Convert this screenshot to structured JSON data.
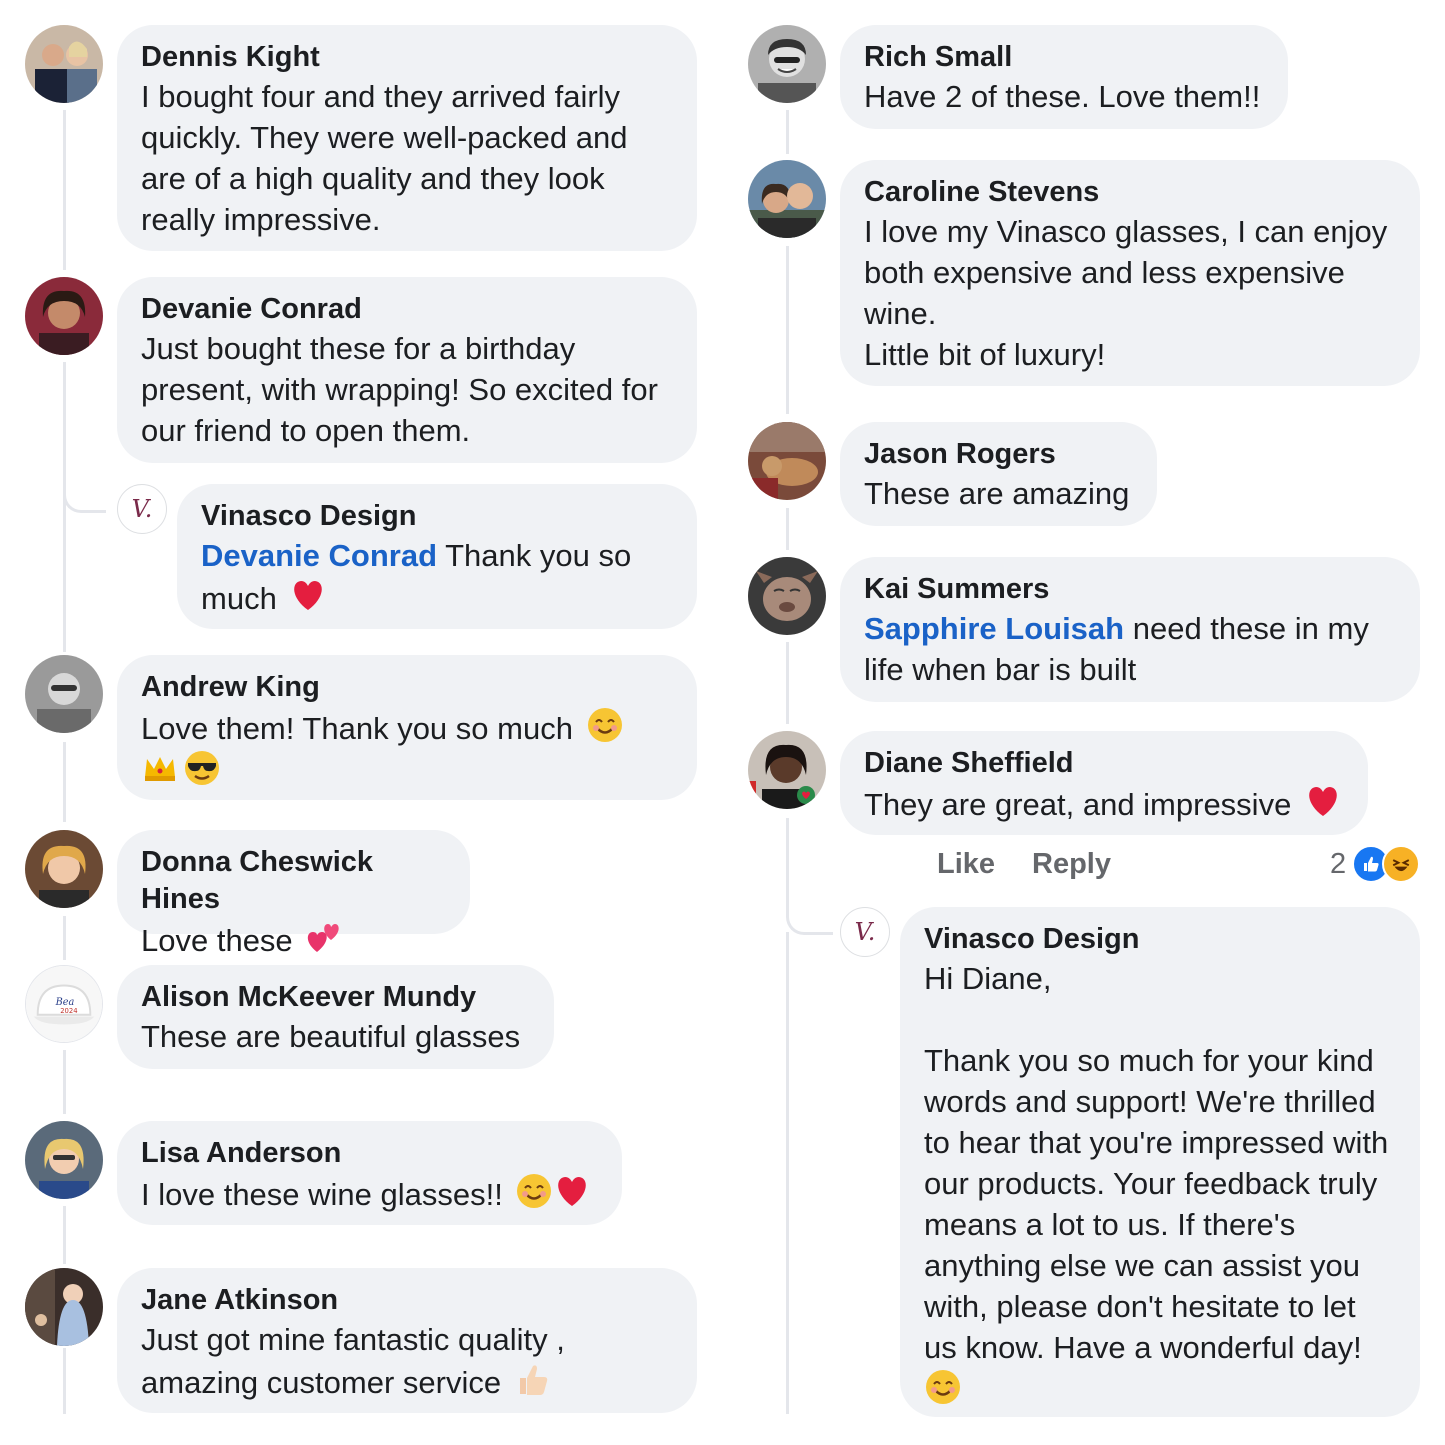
{
  "left_column": [
    {
      "author": "Dennis Kight",
      "text": "I bought four and they arrived fairly quickly. They were well-packed and are of a high quality and they look really impressive."
    },
    {
      "author": "Devanie Conrad",
      "text": "Just bought these for a birthday present, with wrapping! So excited for our friend to open them."
    },
    {
      "author": "Vinasco Design",
      "mention": "Devanie Conrad",
      "text": "Thank you so much"
    },
    {
      "author": "Andrew King",
      "text": "Love them! Thank you so much"
    },
    {
      "author": "Donna Cheswick Hines",
      "text": "Love these"
    },
    {
      "author": "Alison McKeever Mundy",
      "text": "These are beautiful glasses"
    },
    {
      "author": "Lisa Anderson",
      "text": "I love these wine glasses!!"
    },
    {
      "author": "Jane Atkinson",
      "text": "Just got mine fantastic quality , amazing customer service"
    }
  ],
  "right_column": [
    {
      "author": "Rich Small",
      "text": "Have 2 of these. Love them!!"
    },
    {
      "author": "Caroline Stevens",
      "text": "I love my Vinasco glasses, I can enjoy both expensive and less expensive wine.\nLittle bit of luxury!"
    },
    {
      "author": "Jason Rogers",
      "text": "These are amazing"
    },
    {
      "author": "Kai Summers",
      "mention": "Sapphire Louisah",
      "text": "need these in my life when bar is built"
    },
    {
      "author": "Diane Sheffield",
      "text": "They are great, and impressive"
    },
    {
      "author": "Vinasco Design",
      "text": "Hi Diane,\n\nThank you so much for your kind words and support! We're thrilled to hear that you're impressed with our products. Your feedback truly means a lot to us. If there's anything else we can assist you with, please don't hesitate to let us know. Have a wonderful day!"
    }
  ],
  "actions": {
    "like": "Like",
    "reply": "Reply",
    "reaction_count": "2"
  },
  "brand": {
    "monogram": "V."
  },
  "colors": {
    "bubble": "#f0f2f5",
    "mention": "#1a62c7",
    "like_reaction": "#1877f2",
    "haha_reaction": "#f7b125",
    "heart": "#e41e3f"
  }
}
